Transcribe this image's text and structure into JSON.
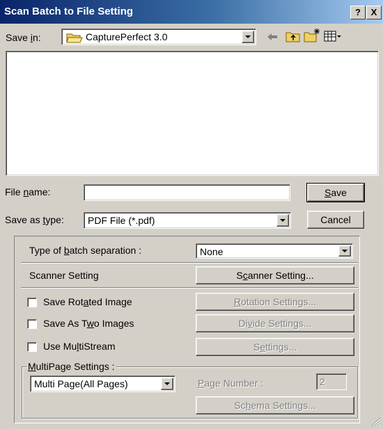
{
  "title": "Scan Batch to File Setting",
  "title_buttons": {
    "help": "?",
    "close": "X"
  },
  "save_in": {
    "label_pre": "Save ",
    "label_key": "i",
    "label_post": "n:",
    "value": "CapturePerfect 3.0"
  },
  "file_name": {
    "label_pre": "File ",
    "label_key": "n",
    "label_post": "ame:",
    "value": ""
  },
  "save_as_type": {
    "label_pre": "Save as ",
    "label_key": "t",
    "label_post": "ype:",
    "value": "PDF File (*.pdf)"
  },
  "buttons": {
    "save": {
      "pre": "",
      "key": "S",
      "post": "ave"
    },
    "cancel": "Cancel"
  },
  "batch_separation": {
    "label_pre": "Type of ",
    "label_key": "b",
    "label_post": "atch separation :",
    "value": "None"
  },
  "scanner_setting": {
    "label": "Scanner Setting",
    "button_pre": "S",
    "button_key": "c",
    "button_post": "anner Setting..."
  },
  "options": [
    {
      "label_pre": "Save Rot",
      "label_key": "a",
      "label_post": "ted Image",
      "checked": false,
      "button_pre": "",
      "button_key": "R",
      "button_post": "otation Settings..."
    },
    {
      "label_pre": "Save As T",
      "label_key": "w",
      "label_post": "o Images",
      "checked": false,
      "button_pre": "Di",
      "button_key": "v",
      "button_post": "ide Settings..."
    },
    {
      "label_pre": "Use Mu",
      "label_key": "l",
      "label_post": "tiStream",
      "checked": false,
      "button_pre": "S",
      "button_key": "e",
      "button_post": "ttings..."
    }
  ],
  "multipage": {
    "group_pre": "",
    "group_key": "M",
    "group_post": "ultiPage Settings :",
    "value": "Multi Page(All Pages)",
    "page_number_pre": "",
    "page_number_key": "P",
    "page_number_post": "age Number :",
    "page_number_value": "2",
    "schema_pre": "Sc",
    "schema_key": "h",
    "schema_post": "ema Settings..."
  },
  "colors": {
    "title_start": "#0a246a",
    "title_end": "#a6caf0",
    "face": "#d4d0c8"
  }
}
